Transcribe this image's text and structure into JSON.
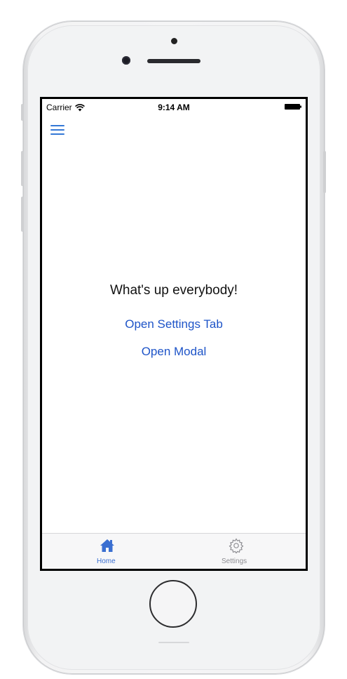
{
  "status_bar": {
    "carrier": "Carrier",
    "time": "9:14 AM"
  },
  "main": {
    "greeting": "What's up everybody!",
    "open_settings_label": "Open Settings Tab",
    "open_modal_label": "Open Modal"
  },
  "tab_bar": {
    "tabs": [
      {
        "label": "Home",
        "icon": "home-icon",
        "selected": true
      },
      {
        "label": "Settings",
        "icon": "gear-icon",
        "selected": false
      }
    ]
  },
  "colors": {
    "accent": "#1e54c8",
    "tab_active": "#3a6fd1",
    "tab_inactive": "#8e8e93"
  }
}
